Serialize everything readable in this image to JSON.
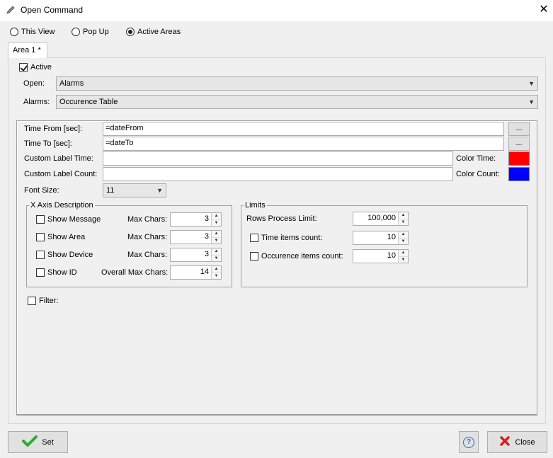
{
  "window": {
    "title": "Open Command",
    "close_symbol": "✕"
  },
  "view_options": [
    {
      "label": "This View",
      "selected": false
    },
    {
      "label": "Pop Up",
      "selected": false
    },
    {
      "label": "Active Areas",
      "selected": true
    }
  ],
  "tab": {
    "label": "Area  1 *"
  },
  "active": {
    "label": "Active",
    "checked": true
  },
  "open": {
    "label": "Open:",
    "value": "Alarms"
  },
  "alarms": {
    "label": "Alarms:",
    "value": "Occurence Table"
  },
  "time_from": {
    "label": "Time From [sec]:",
    "value": "=dateFrom",
    "button": "..."
  },
  "time_to": {
    "label": "Time To [sec]:",
    "value": "=dateTo",
    "button": "..."
  },
  "custom_label_time": {
    "label": "Custom Label Time:",
    "value": ""
  },
  "custom_label_count": {
    "label": "Custom Label Count:",
    "value": ""
  },
  "color_time": {
    "label": "Color Time:",
    "color": "#ff0000"
  },
  "color_count": {
    "label": "Color Count:",
    "color": "#0000ff"
  },
  "font_size": {
    "label": "Font Size:",
    "value": "11"
  },
  "x_axis": {
    "title": "X Axis Description",
    "items": [
      {
        "label": "Show Message",
        "checked": false,
        "max_label": "Max Chars:",
        "max_value": "3"
      },
      {
        "label": "Show Area",
        "checked": false,
        "max_label": "Max Chars:",
        "max_value": "3"
      },
      {
        "label": "Show Device",
        "checked": false,
        "max_label": "Max Chars:",
        "max_value": "3"
      },
      {
        "label": "Show ID",
        "checked": false,
        "max_label": "Overall Max Chars:",
        "max_value": "14"
      }
    ]
  },
  "limits": {
    "title": "Limits",
    "rows_process": {
      "label": "Rows Process Limit:",
      "value": "100,000"
    },
    "time_items": {
      "label": "Time items count:",
      "checked": false,
      "value": "10"
    },
    "occurence_items": {
      "label": "Occurence items count:",
      "checked": false,
      "value": "10"
    }
  },
  "filter": {
    "label": "Filter:",
    "checked": false
  },
  "buttons": {
    "set": "Set",
    "help": "?",
    "close": "Close"
  },
  "colors": {
    "set_check": "#2eaa2e",
    "close_x": "#d42020",
    "help": "#1a6ed8"
  }
}
